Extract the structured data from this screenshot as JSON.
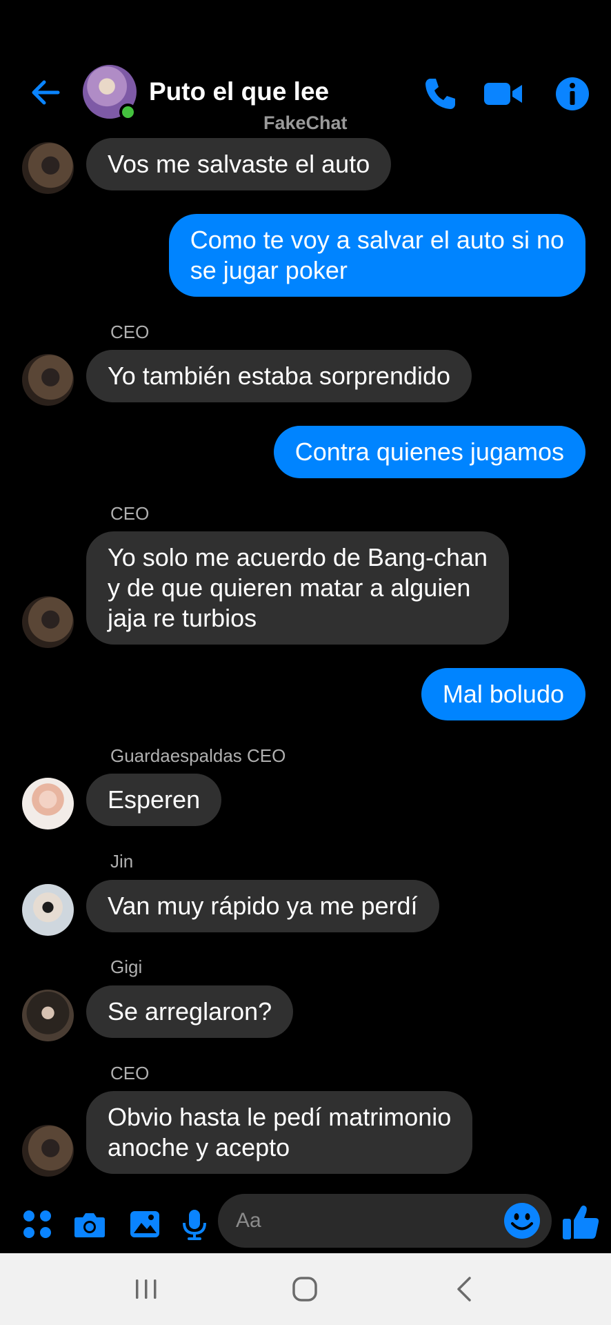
{
  "header": {
    "title": "Puto el que lee",
    "subtitle": "FakeChat",
    "back_icon": "arrow-left-icon",
    "call_icon": "phone-icon",
    "video_icon": "video-camera-icon",
    "info_icon": "info-icon"
  },
  "messages": [
    {
      "sender": "",
      "text_lines": [
        "Vos me salvaste el auto"
      ],
      "outgoing": false
    },
    {
      "sender": "",
      "text_lines": [
        "Como te voy a salvar el auto si no",
        "se jugar poker"
      ],
      "outgoing": true
    },
    {
      "sender": "CEO",
      "text_lines": [
        "Yo también estaba sorprendido"
      ],
      "outgoing": false
    },
    {
      "sender": "",
      "text_lines": [
        "Contra quienes jugamos"
      ],
      "outgoing": true
    },
    {
      "sender": "CEO",
      "text_lines": [
        "Yo solo me acuerdo de Bang-chan",
        "y de que quieren matar a alguien",
        "jaja re turbios"
      ],
      "outgoing": false
    },
    {
      "sender": "",
      "text_lines": [
        "Mal boludo"
      ],
      "outgoing": true
    },
    {
      "sender": "Guardaespaldas CEO",
      "text_lines": [
        "Esperen"
      ],
      "outgoing": false
    },
    {
      "sender": "Jin",
      "text_lines": [
        "Van muy rápido ya me perdí"
      ],
      "outgoing": false
    },
    {
      "sender": "Gigi",
      "text_lines": [
        "Se arreglaron?"
      ],
      "outgoing": false
    },
    {
      "sender": "CEO",
      "text_lines": [
        "Obvio hasta le pedí matrimonio",
        "anoche y acepto"
      ],
      "outgoing": false
    }
  ],
  "composer": {
    "placeholder": "Aa",
    "icons": [
      "apps-icon",
      "camera-icon",
      "image-icon",
      "microphone-icon",
      "emoji-icon",
      "thumbs-up-icon"
    ]
  },
  "navbar": {
    "icons": [
      "recents-icon",
      "home-icon",
      "back-chevron-icon"
    ]
  },
  "colors": {
    "accent": "#0084ff",
    "background": "#000000",
    "incoming_bubble": "#303030",
    "online": "#44c13e",
    "navbar": "#f1f1f1"
  }
}
